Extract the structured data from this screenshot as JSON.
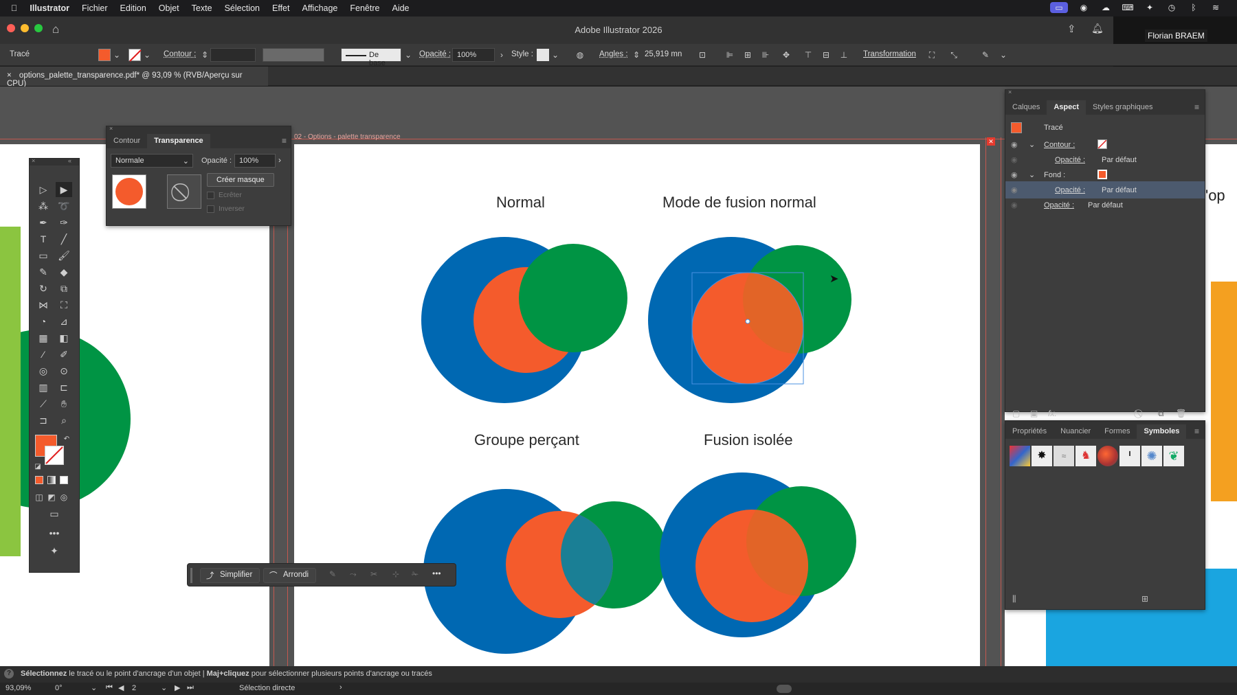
{
  "menubar": {
    "apple": "",
    "items": [
      "Illustrator",
      "Fichier",
      "Edition",
      "Objet",
      "Texte",
      "Sélection",
      "Effet",
      "Affichage",
      "Fenêtre",
      "Aide"
    ]
  },
  "window": {
    "title": "Adobe Illustrator 2026"
  },
  "presenter": {
    "name": "Florian BRAEM"
  },
  "controlbar": {
    "object_type": "Tracé",
    "contour_label": "Contour :",
    "stroke_profile": "De base",
    "opacity_label": "Opacité :",
    "opacity_value": "100%",
    "style_label": "Style :",
    "angles_label": "Angles :",
    "angles_value": "25,919 mn",
    "transform_label": "Transformation"
  },
  "document_tab": {
    "label": "options_palette_transparence.pdf* @ 93,09 % (RVB/Aperçu sur CPU)"
  },
  "artboard": {
    "name": "02 - Options - palette transparence"
  },
  "transparency_panel": {
    "tabs": [
      "Contour",
      "Transparence"
    ],
    "active_tab": "Transparence",
    "blend_mode": "Normale",
    "opacity_label": "Opacité :",
    "opacity_value": "100%",
    "make_mask": "Créer masque",
    "clip": "Ecrêter",
    "invert": "Inverser"
  },
  "aspect_panel": {
    "tabs": [
      "Calques",
      "Aspect",
      "Styles graphiques"
    ],
    "active_tab": "Aspect",
    "object": "Tracé",
    "stroke_label": "Contour :",
    "stroke_opacity_label": "Opacité :",
    "stroke_opacity_value": "Par défaut",
    "fill_label": "Fond :",
    "fill_opacity_label": "Opacité :",
    "fill_opacity_value": "Par défaut",
    "obj_opacity_label": "Opacité :",
    "obj_opacity_value": "Par défaut"
  },
  "symbols_panel": {
    "tabs": [
      "Propriétés",
      "Nuancier",
      "Formes",
      "Symboles"
    ],
    "active_tab": "Symboles"
  },
  "artwork": {
    "titles": [
      "Normal",
      "Mode de fusion normal",
      "Groupe perçant",
      "Fusion isolée"
    ],
    "colors": {
      "blue": "#0068b2",
      "orange": "#f45b2c",
      "green": "#009444",
      "teal": "#1a7f95",
      "dark_orange": "#e26427"
    }
  },
  "rightboard": {
    "snippet": "'op"
  },
  "contextbar": {
    "simplify": "Simplifier",
    "round": "Arrondi",
    "more": "•••"
  },
  "hintbar": {
    "text1_bold": "Sélectionnez",
    "text1": " le tracé ou le point d'ancrage d'un objet  |  ",
    "text2_bold": "Maj+cliquez",
    "text2": " pour sélectionner plusieurs points d'ancrage ou tracés"
  },
  "statusbar": {
    "zoom": "93,09%",
    "rotation": "0°",
    "artboard_num": "2",
    "tool": "Sélection directe"
  }
}
